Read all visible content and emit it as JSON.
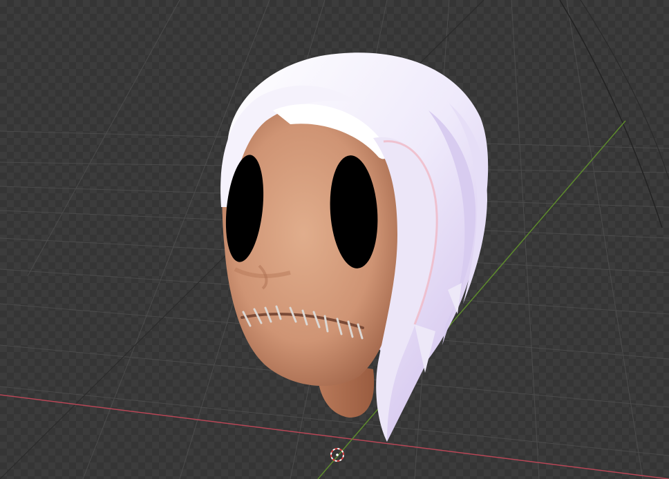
{
  "viewport": {
    "mode": "3d-viewport-rendered",
    "background_colors": {
      "checker_dark": "#353535",
      "checker_light": "#3d3d3d"
    },
    "grid_color": "#555555",
    "axis_colors": {
      "x": "#c44a5a",
      "y": "#6d9a34"
    },
    "origin_cursor_icon": "3d-cursor-icon"
  },
  "model": {
    "subject": "character-head",
    "colors": {
      "skin": "#d49c7a",
      "skin_shadow": "#a86a4c",
      "hair": "#f2eefa",
      "hair_shadow": "#c9b6e6",
      "hair_rim": "#f3c1c9",
      "eyes": "#000000",
      "stitches": "#d8d4d0"
    }
  }
}
